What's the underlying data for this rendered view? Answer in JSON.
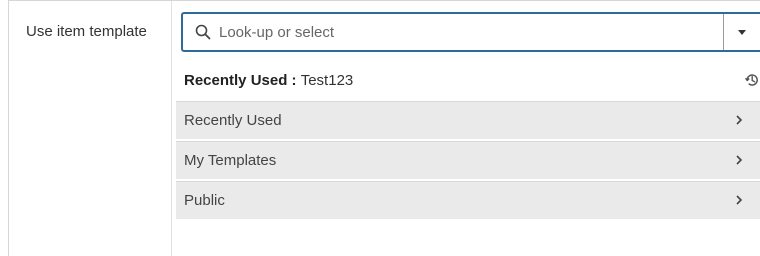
{
  "field": {
    "label": "Use item template"
  },
  "combo": {
    "placeholder": "Look-up or select",
    "value": ""
  },
  "dropdown": {
    "recent": {
      "heading": "Recently Used : ",
      "value": "Test123"
    },
    "categories": [
      {
        "label": "Recently Used"
      },
      {
        "label": "My Templates"
      },
      {
        "label": "Public"
      }
    ]
  },
  "icons": {
    "search": "search-icon",
    "caret": "caret-down-icon",
    "history": "history-icon",
    "chevron": "chevron-right-icon"
  },
  "colors": {
    "focus_border": "#2e6b9a",
    "row_background": "#eaeaea"
  }
}
